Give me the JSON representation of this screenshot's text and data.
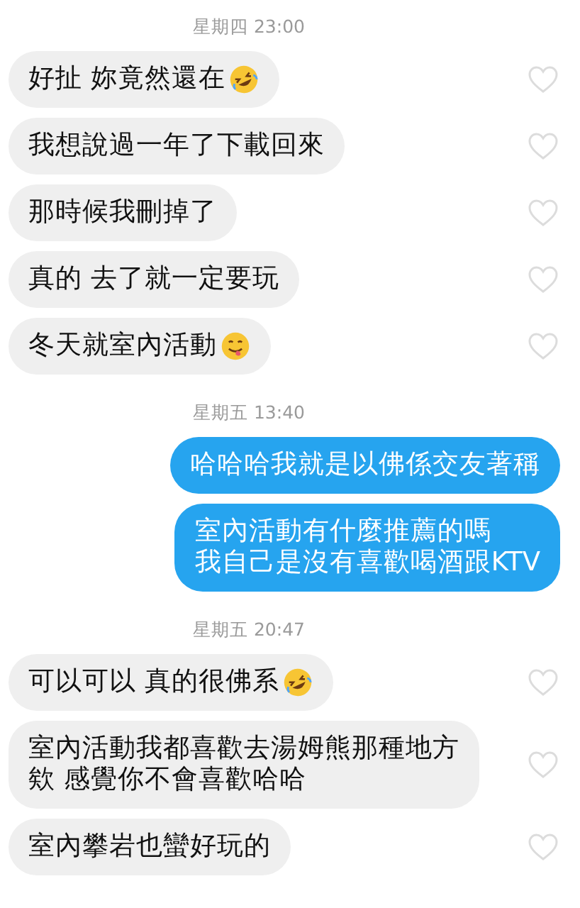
{
  "groups": [
    {
      "time": "星期四 23:00",
      "messages": [
        {
          "kind": "incoming",
          "lines": [
            "好扯 妳竟然還在"
          ],
          "emoji": {
            "kind": "laughing"
          },
          "liked": false
        },
        {
          "kind": "incoming",
          "lines": [
            "我想說過一年了下載回來"
          ],
          "liked": false
        },
        {
          "kind": "incoming",
          "lines": [
            "那時候我刪掉了"
          ],
          "liked": false
        },
        {
          "kind": "incoming",
          "lines": [
            "真的 去了就一定要玩"
          ],
          "liked": false
        },
        {
          "kind": "incoming",
          "lines": [
            "冬天就室內活動"
          ],
          "emoji": {
            "kind": "tongue"
          },
          "liked": false
        }
      ]
    },
    {
      "time": "星期五 13:40",
      "messages": [
        {
          "kind": "outgoing",
          "lines": [
            "哈哈哈我就是以佛係交友著稱"
          ]
        },
        {
          "kind": "outgoing",
          "lines": [
            "室內活動有什麼推薦的嗎",
            "我自己是沒有喜歡喝酒跟KTV"
          ]
        }
      ]
    },
    {
      "time": "星期五 20:47",
      "messages": [
        {
          "kind": "incoming",
          "lines": [
            "可以可以 真的很佛系"
          ],
          "emoji": {
            "kind": "laughing"
          },
          "liked": false
        },
        {
          "kind": "incoming",
          "lines": [
            "室內活動我都喜歡去湯姆熊那種地方",
            "欸 感覺你不會喜歡哈哈"
          ],
          "liked": false
        },
        {
          "kind": "incoming",
          "lines": [
            "室內攀岩也蠻好玩的"
          ],
          "liked": false
        }
      ]
    }
  ]
}
